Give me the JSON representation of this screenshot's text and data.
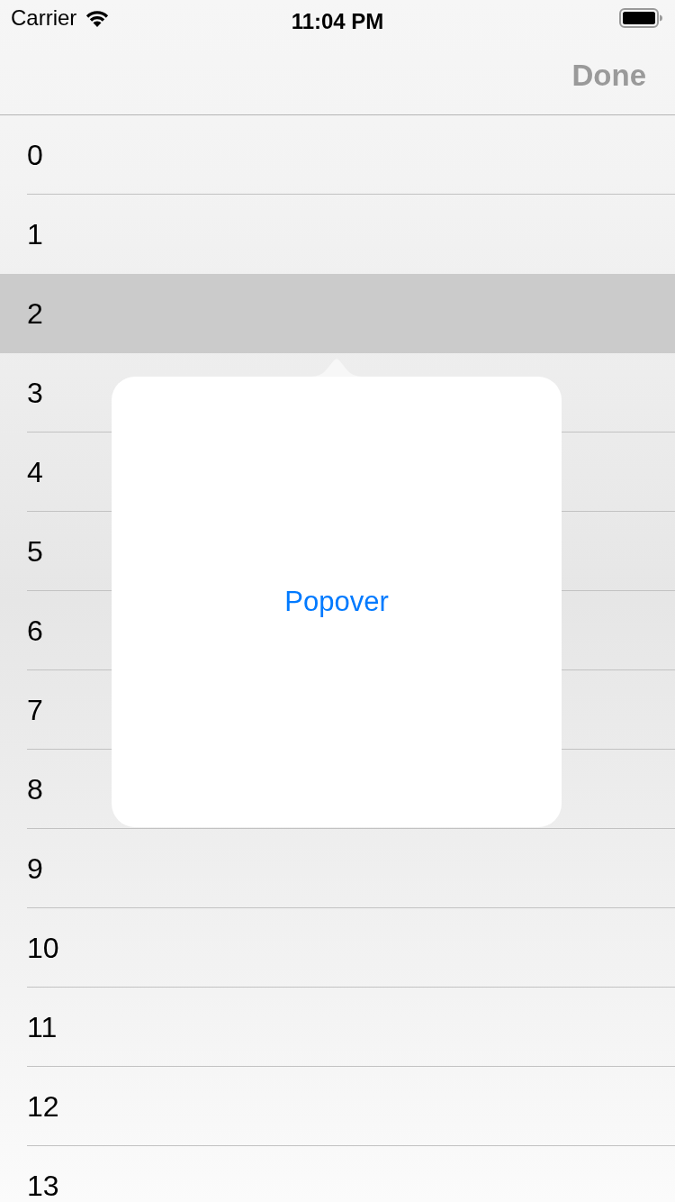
{
  "status_bar": {
    "carrier": "Carrier",
    "time": "11:04 PM"
  },
  "nav_bar": {
    "done_button": {
      "label": "Done",
      "disabled": true
    }
  },
  "list": {
    "rows": [
      {
        "label": "0",
        "selected": false
      },
      {
        "label": "1",
        "selected": false
      },
      {
        "label": "2",
        "selected": true
      },
      {
        "label": "3",
        "selected": false
      },
      {
        "label": "4",
        "selected": false
      },
      {
        "label": "5",
        "selected": false
      },
      {
        "label": "6",
        "selected": false
      },
      {
        "label": "7",
        "selected": false
      },
      {
        "label": "8",
        "selected": false
      },
      {
        "label": "9",
        "selected": false
      },
      {
        "label": "10",
        "selected": false
      },
      {
        "label": "11",
        "selected": false
      },
      {
        "label": "12",
        "selected": false
      },
      {
        "label": "13",
        "selected": false
      }
    ]
  },
  "popover": {
    "content": "Popover"
  }
}
